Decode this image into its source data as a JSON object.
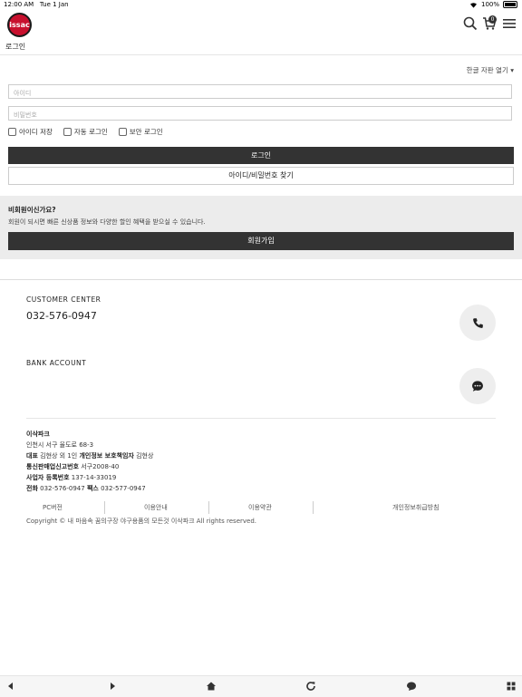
{
  "status_bar": {
    "time": "12:00 AM",
    "date": "Tue 1 Jan",
    "battery": "100%"
  },
  "header": {
    "logo_text": "issac",
    "cart_count": "0"
  },
  "page_title": "로그인",
  "lang_selector": "한글 자판 열기 ▾",
  "login": {
    "id_placeholder": "아이디",
    "pw_placeholder": "비밀번호",
    "save_id": "아이디 저장",
    "auto_login": "자동 로그인",
    "secure_login": "보안 로그인",
    "login_button": "로그인",
    "find_button": "아이디/비밀번호 찾기"
  },
  "guest": {
    "heading": "비회원이신가요?",
    "desc": "회원이 되시면 빠른 신상품 정보와 다양한 할인 혜택을 받으실 수 있습니다.",
    "join_button": "회원가입"
  },
  "footer": {
    "cs_title": "CUSTOMER CENTER",
    "phone": "032-576-0947",
    "bank_title": "BANK ACCOUNT",
    "company": "이삭파크",
    "address": "인천시 서구 율도로 68-3",
    "rep_label": "대표",
    "rep_value": "김현상 외 1인",
    "privacy_label": "개인정보 보호책임자",
    "privacy_value": "김현상",
    "mail_label": "통신판매업신고번호",
    "mail_value": "서구2008-40",
    "biz_label": "사업자 등록번호",
    "biz_value": "137-14-33019",
    "tel_label": "전화",
    "tel_value": "032-576-0947",
    "fax_label": "팩스",
    "fax_value": "032-577-0947",
    "links": [
      "PC버전",
      "이용안내",
      "이용약관",
      "개인정보취급방침"
    ],
    "copyright": "Copyright © 내 마음속 꿈의구장 야구용품의 모든것 이삭파크 All rights reserved."
  },
  "colors": {
    "dark_button": "#333333",
    "guest_bg": "#ececec",
    "logo_red": "#c8102e"
  }
}
